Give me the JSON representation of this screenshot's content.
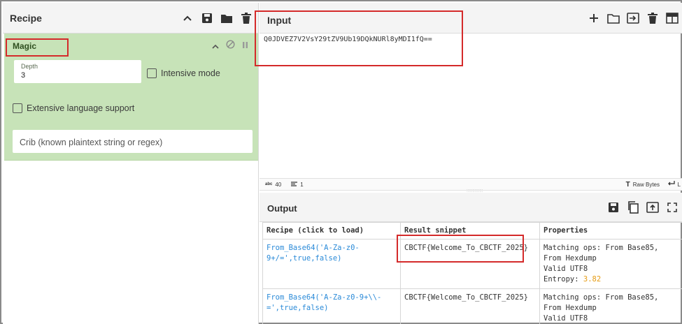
{
  "recipe": {
    "title": "Recipe",
    "operation": {
      "name": "Magic",
      "depth_label": "Depth",
      "depth_value": "3",
      "intensive_mode_label": "Intensive mode",
      "extensive_language_label": "Extensive language support",
      "crib_placeholder": "Crib (known plaintext string or regex)"
    }
  },
  "input": {
    "title": "Input",
    "text": "Q0JDVEZ7V2VsY29tZV9Ub19DQkNURl8yMDI1fQ==",
    "status": {
      "chars_label": "abc",
      "chars": "40",
      "lines": "1",
      "raw_bytes_label": "Raw Bytes",
      "eol_label": "L"
    }
  },
  "output": {
    "title": "Output",
    "columns": [
      "Recipe (click to load)",
      "Result snippet",
      "Properties"
    ],
    "rows": [
      {
        "recipe_line1": "From_Base64('A-Za-z0-",
        "recipe_line2": "9+/=',true,false)",
        "result": "CBCTF{Welcome_To_CBCTF_2025}",
        "prop_line1": "Matching ops: From Base85,",
        "prop_line2": "From Hexdump",
        "prop_line3": "Valid UTF8",
        "entropy_label": "Entropy: ",
        "entropy_value": "3.82"
      },
      {
        "recipe_line1": "From_Base64('A-Za-z0-9+\\\\-",
        "recipe_line2": "=',true,false)",
        "result": "CBCTF{Welcome_To_CBCTF_2025}",
        "prop_line1": "Matching ops: From Base85,",
        "prop_line2": "From Hexdump",
        "prop_line3": "Valid UTF8"
      }
    ]
  },
  "colors": {
    "operation_bg": "#c7e3b8",
    "highlight": "#d42a2a",
    "recipe_link": "#2a8ad8",
    "entropy": "#e69b12"
  }
}
